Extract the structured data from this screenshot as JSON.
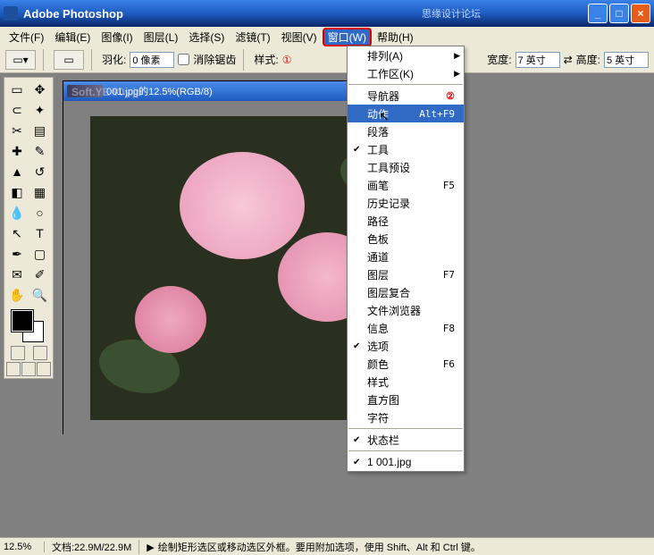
{
  "title": "Adobe Photoshop",
  "watermark": "思缘设计论坛",
  "watermark2": "Soft.YE 90y.jp",
  "menus": {
    "file": "文件(F)",
    "edit": "编辑(E)",
    "image": "图像(I)",
    "layer": "图层(L)",
    "select": "选择(S)",
    "filter": "滤镜(T)",
    "view": "视图(V)",
    "window": "窗口(W)",
    "help": "帮助(H)"
  },
  "optbar": {
    "feather": "羽化:",
    "featherVal": "0 像素",
    "antialias": "消除锯齿",
    "style": "样式:",
    "width": "宽度:",
    "widthVal": "7 英寸",
    "height": "高度:",
    "heightVal": "5 英寸",
    "annot1": "①"
  },
  "docTitle": "001.jpg的12.5%(RGB/8)",
  "menu": {
    "arrange": "排列(A)",
    "workspace": "工作区(K)",
    "navigator": "导航器",
    "annot2": "②",
    "actions": "动作",
    "actionsSc": "Alt+F9",
    "paragraph": "段落",
    "tools": "工具",
    "toolPresets": "工具预设",
    "brushes": "画笔",
    "brushesSc": "F5",
    "history": "历史记录",
    "paths": "路径",
    "swatches": "色板",
    "channels": "通道",
    "layers": "图层",
    "layersSc": "F7",
    "layerComps": "图层复合",
    "fileBrowser": "文件浏览器",
    "info": "信息",
    "infoSc": "F8",
    "options": "选项",
    "color": "颜色",
    "colorSc": "F6",
    "styles": "样式",
    "histogram": "直方图",
    "character": "字符",
    "statusBar": "状态栏",
    "doc1": "1 001.jpg"
  },
  "status": {
    "zoom": "12.5%",
    "docSize": "文档:22.9M/22.9M",
    "hint": "绘制矩形选区或移动选区外框。要用附加选项，使用 Shift、Alt 和 Ctrl 键。"
  }
}
